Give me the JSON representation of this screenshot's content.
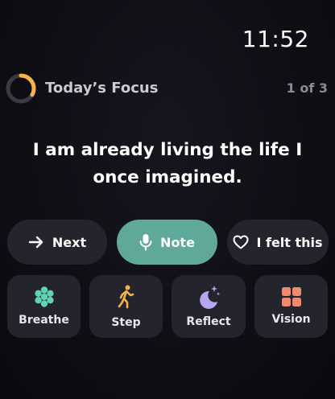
{
  "status_bar": {
    "time": "11:52"
  },
  "header": {
    "title": "Today’s Focus",
    "count": "1 of 3",
    "progress": 0.33,
    "progress_color": "#f5b34a"
  },
  "affirmation": {
    "line1": "I am already living the life I",
    "line2": "once imagined."
  },
  "actions": {
    "next": {
      "label": "Next",
      "icon": "arrow-right-icon"
    },
    "note": {
      "label": "Note",
      "icon": "microphone-icon",
      "color": "#5fa89a"
    },
    "felt": {
      "label": "I felt this",
      "icon": "heart-icon"
    }
  },
  "tools": [
    {
      "label": "Breathe",
      "icon": "flower-icon",
      "color": "#5fd3b6"
    },
    {
      "label": "Step",
      "icon": "walking-person-icon",
      "color": "#f5b34a"
    },
    {
      "label": "Reflect",
      "icon": "moon-stars-icon",
      "color": "#b7a6f0"
    },
    {
      "label": "Vision",
      "icon": "grid-icon",
      "color": "#f08a6c"
    }
  ]
}
